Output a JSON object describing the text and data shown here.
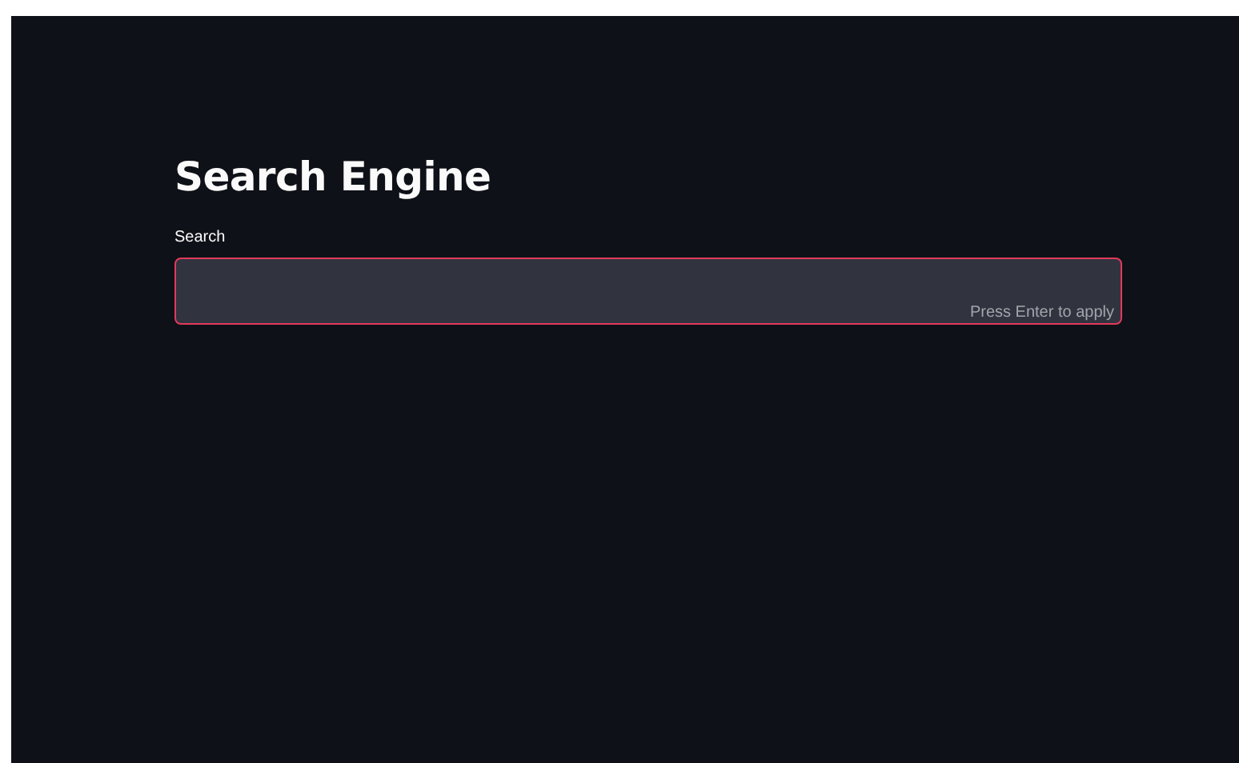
{
  "title": "Search Engine",
  "search": {
    "label": "Search",
    "hint": "Press Enter to apply",
    "focused": true
  }
}
